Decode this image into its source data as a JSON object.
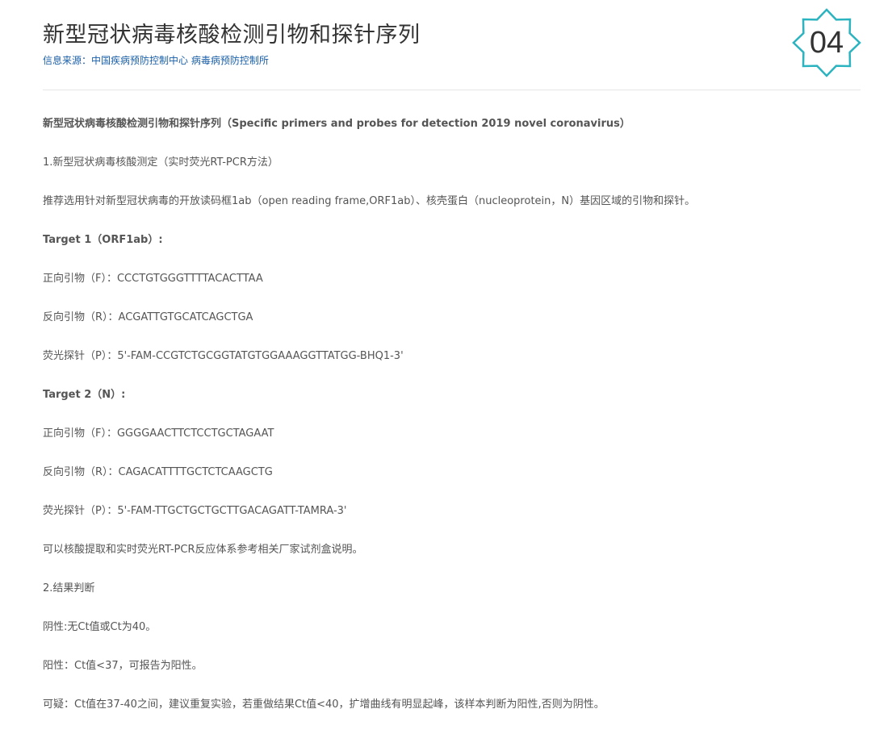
{
  "header": {
    "title": "新型冠状病毒核酸检测引物和探针序列",
    "source": "信息来源：中国疾病预防控制中心 病毒病预防控制所",
    "badge_number": "04",
    "badge_color": "#2bb3c0"
  },
  "content": {
    "paragraphs": [
      {
        "text": "新型冠状病毒核酸检测引物和探针序列（Specific primers and probes for detection 2019 novel coronavirus）",
        "bold": true
      },
      {
        "text": "1.新型冠状病毒核酸测定（实时荧光RT-PCR方法）",
        "bold": false
      },
      {
        "text": "推荐选用针对新型冠状病毒的开放读码框1ab（open reading frame,ORF1ab）、核壳蛋白（nucleoprotein，N）基因区域的引物和探针。",
        "bold": false
      },
      {
        "text": "Target 1（ORF1ab）:",
        "bold": true
      },
      {
        "text": "正向引物（F）：CCCTGTGGGTTTTACACTTAA",
        "bold": false
      },
      {
        "text": "反向引物（R）：ACGATTGTGCATCAGCTGA",
        "bold": false
      },
      {
        "text": "荧光探针（P）：5'-FAM-CCGTCTGCGGTATGTGGAAAGGTTATGG-BHQ1-3'",
        "bold": false
      },
      {
        "text": "Target 2（N）:",
        "bold": true
      },
      {
        "text": "正向引物（F）：GGGGAACTTCTCCTGCTAGAAT",
        "bold": false
      },
      {
        "text": "反向引物（R）：CAGACATTTTGCTCTCAAGCTG",
        "bold": false
      },
      {
        "text": "荧光探针（P）：5'-FAM-TTGCTGCTGCTTGACAGATT-TAMRA-3'",
        "bold": false
      },
      {
        "text": "可以核酸提取和实时荧光RT-PCR反应体系参考相关厂家试剂盒说明。",
        "bold": false
      },
      {
        "text": "2.结果判断",
        "bold": false
      },
      {
        "text": "阴性:无Ct值或Ct为40。",
        "bold": false
      },
      {
        "text": "阳性：Ct值<37，可报告为阳性。",
        "bold": false
      },
      {
        "text": "可疑：Ct值在37-40之间，建议重复实验，若重做结果Ct值<40，扩增曲线有明显起峰，该样本判断为阳性,否则为阴性。",
        "bold": false
      }
    ]
  }
}
